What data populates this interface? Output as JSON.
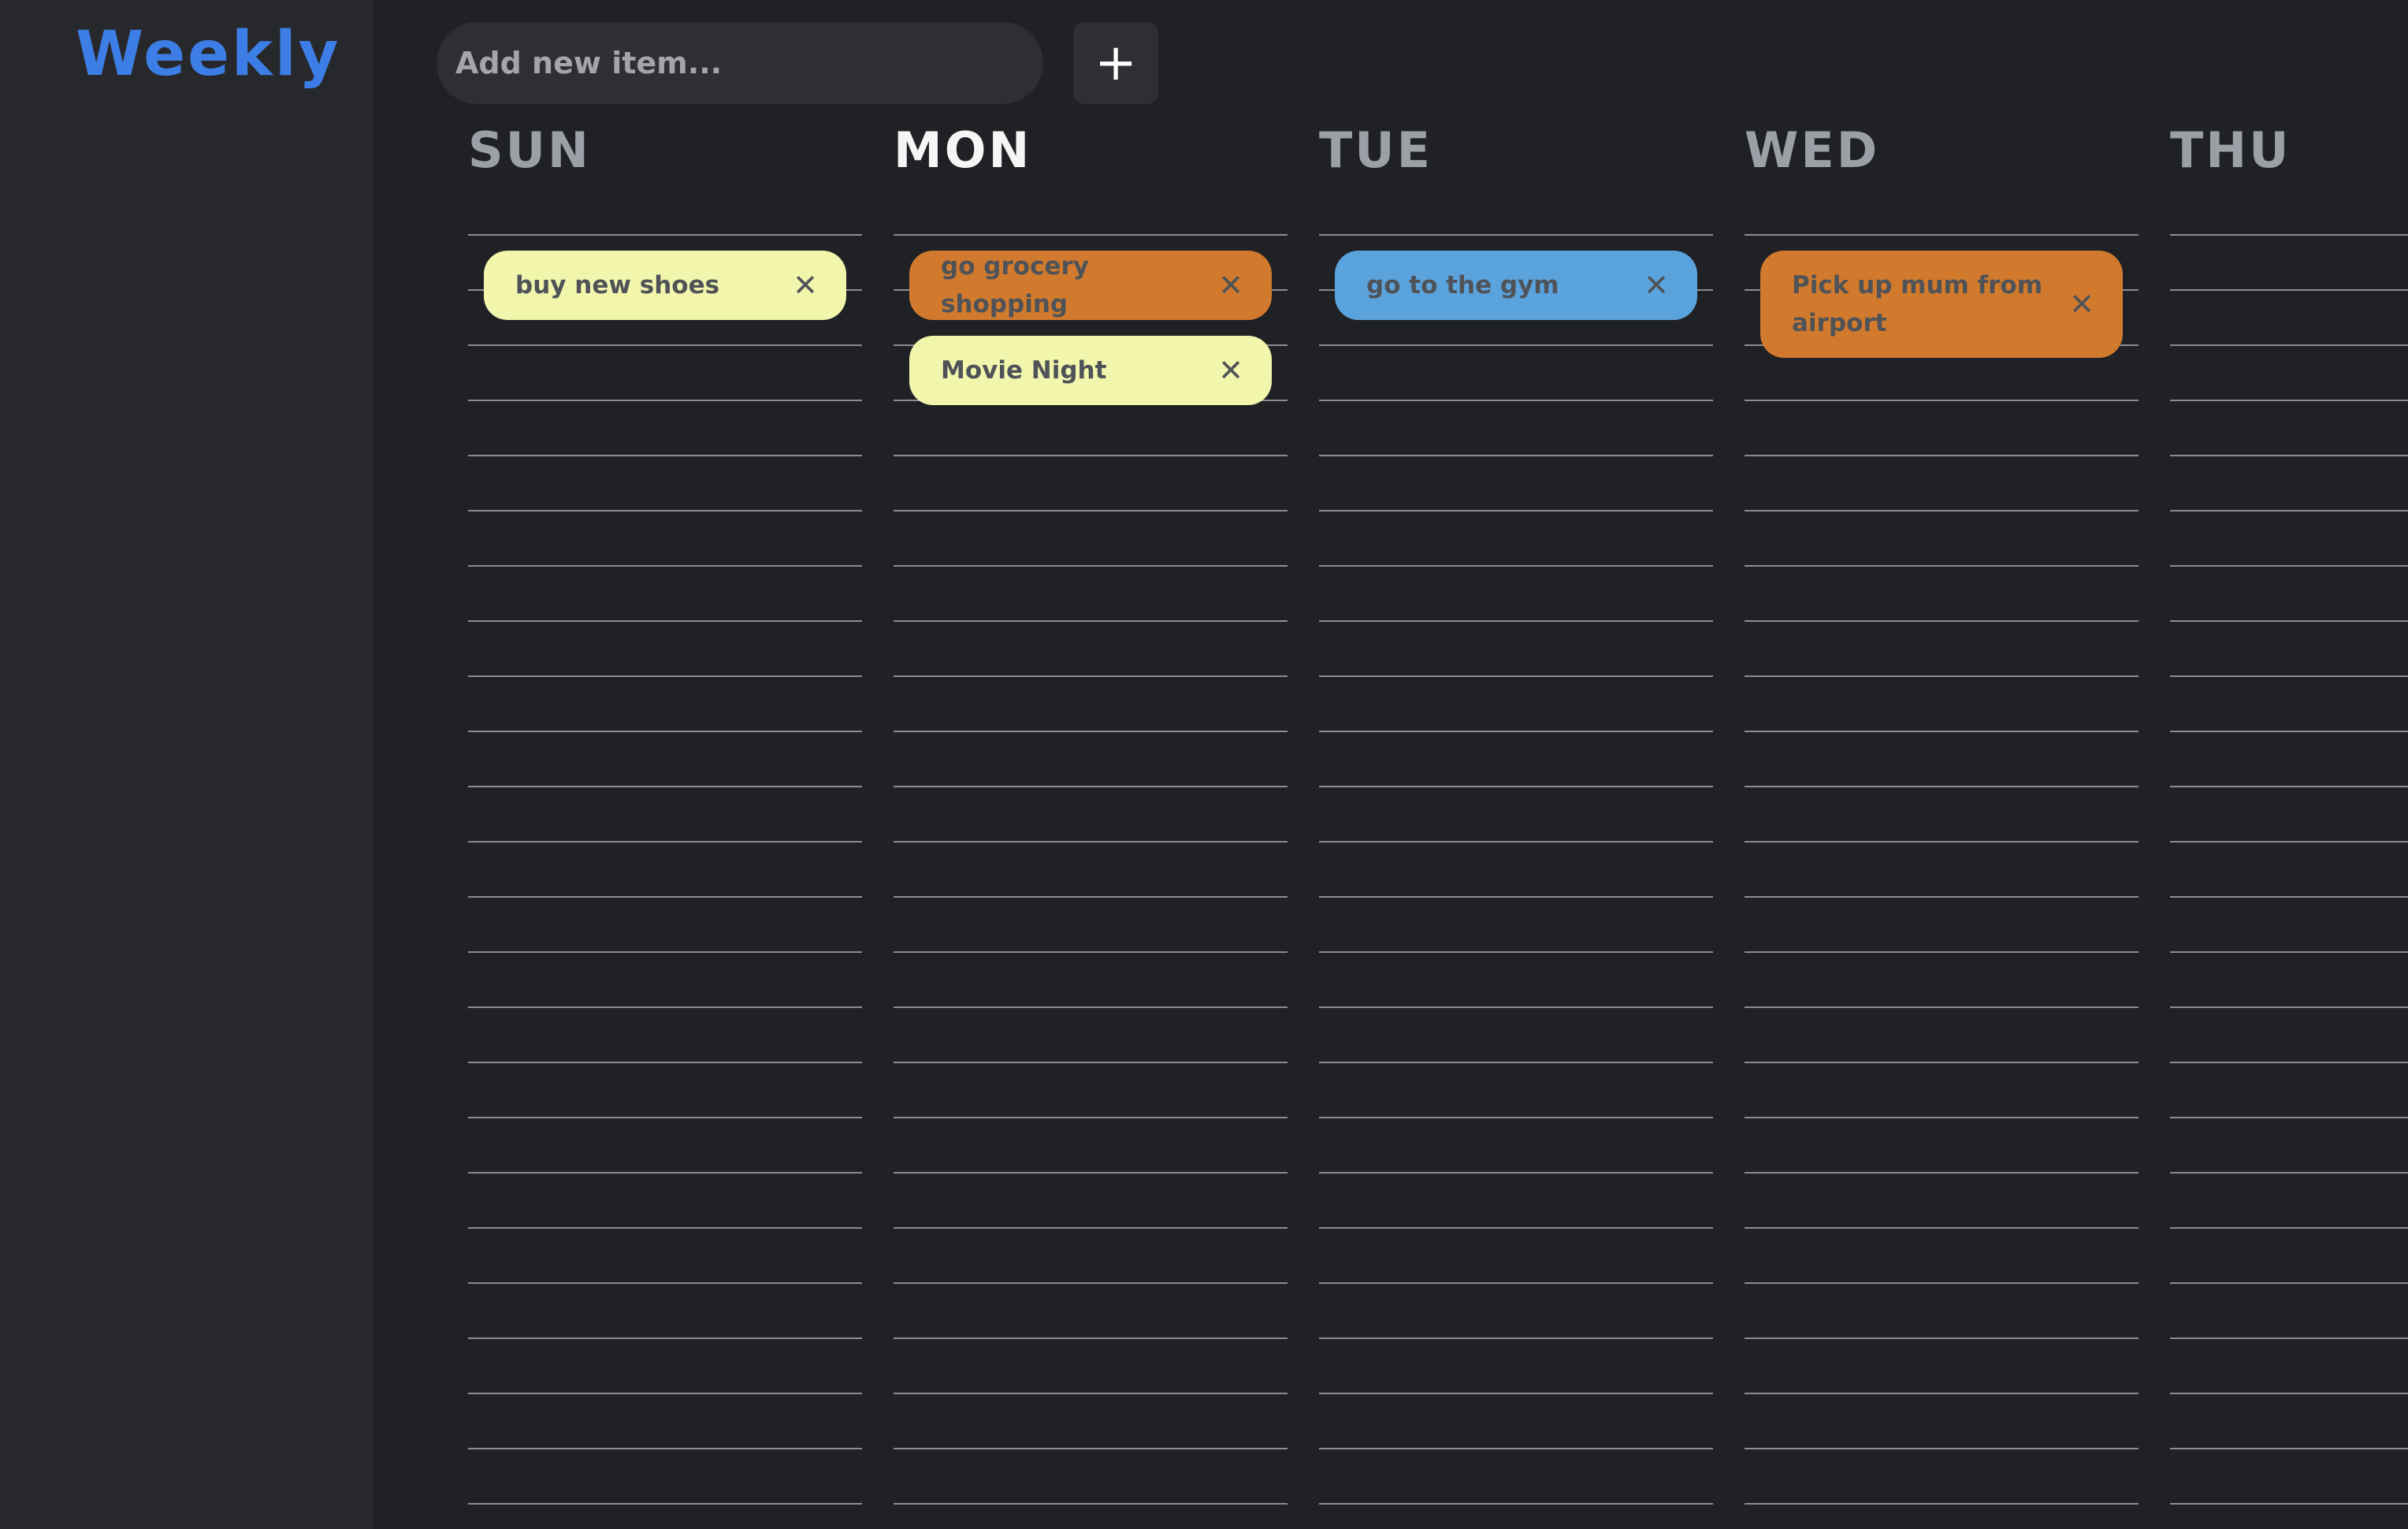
{
  "app": {
    "title": "Weekly"
  },
  "new_item": {
    "placeholder": "Add new item...",
    "add_label": "+"
  },
  "days": [
    {
      "label": "SUN",
      "active": false,
      "tasks": [
        {
          "text": "buy new shoes",
          "color": "#f1f6ac"
        }
      ]
    },
    {
      "label": "MON",
      "active": true,
      "tasks": [
        {
          "text": "go grocery shopping",
          "color": "#d17a2d"
        },
        {
          "text": "Movie Night",
          "color": "#f1f6ac"
        }
      ]
    },
    {
      "label": "TUE",
      "active": false,
      "tasks": [
        {
          "text": "go to the gym",
          "color": "#5ba3dc"
        }
      ]
    },
    {
      "label": "WED",
      "active": false,
      "tasks": [
        {
          "text": "Pick up mum from airport",
          "color": "#d17a2d"
        }
      ]
    },
    {
      "label": "THU",
      "active": false,
      "tasks": []
    }
  ],
  "icons": {
    "close": "close-icon",
    "add": "plus-icon"
  },
  "colors": {
    "accent": "#3d7ee6",
    "background": "#202124",
    "sidebar": "#27282c",
    "yellow_task": "#f1f6ac",
    "orange_task": "#d17a2d",
    "blue_task": "#5ba3dc"
  }
}
